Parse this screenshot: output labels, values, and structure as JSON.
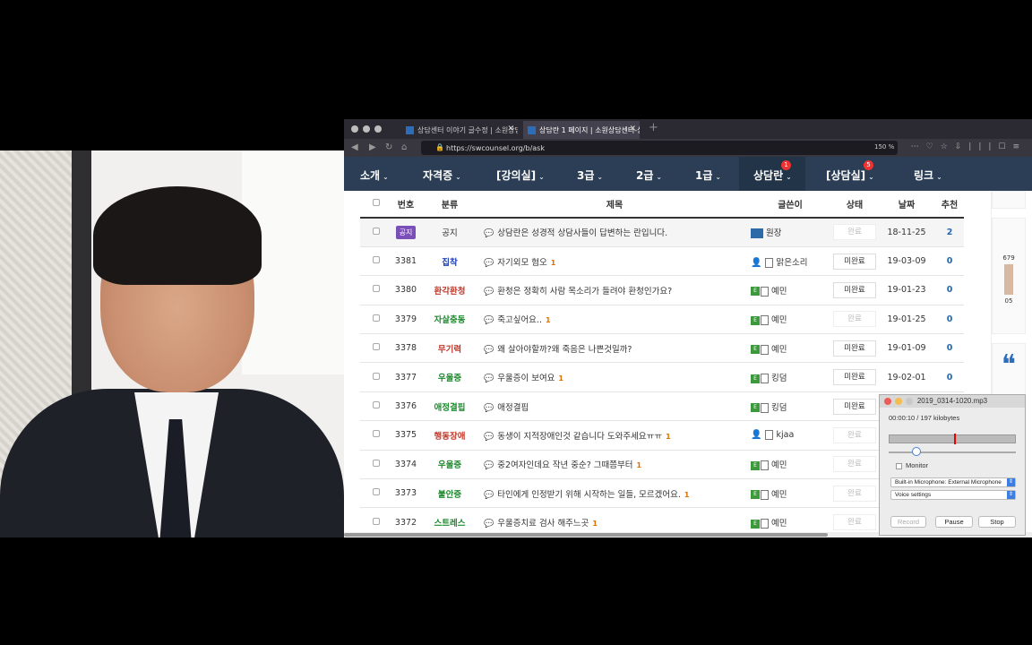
{
  "browser": {
    "tabs": [
      {
        "title": "상담센터 이야기 글수정 | 소원상담센"
      },
      {
        "title": "상담란 1 페이지 | 소원상담센터-상담"
      }
    ],
    "url": "https://swcounsel.org/b/ask",
    "zoom": "150 %"
  },
  "nav": {
    "items": [
      {
        "label": "소개"
      },
      {
        "label": "자격증"
      },
      {
        "label": "[강의실]"
      },
      {
        "label": "3급"
      },
      {
        "label": "2급"
      },
      {
        "label": "1급"
      },
      {
        "label": "상담란",
        "badge": "1"
      },
      {
        "label": "[상담실]",
        "badge": "5"
      },
      {
        "label": "링크"
      }
    ]
  },
  "table": {
    "headers": [
      "번호",
      "분류",
      "제목",
      "글쓴이",
      "상태",
      "날짜",
      "추천"
    ],
    "rows": [
      {
        "num": "공지",
        "cat": "공지",
        "cat_color": "#333333",
        "title": "상담란은 성경적 상담사들이 답변하는 란입니다.",
        "comments": "",
        "author": "원장",
        "status": "완료",
        "date": "18-11-25",
        "rec": "2"
      },
      {
        "num": "3381",
        "cat": "집착",
        "cat_color": "#1f3fb0",
        "title": "자기외모 혐오",
        "comments": "1",
        "author": "맑은소리",
        "status": "미완료",
        "date": "19-03-09",
        "rec": "0"
      },
      {
        "num": "3380",
        "cat": "환각환청",
        "cat_color": "#c0392b",
        "title": "환청은 정확히 사람 목소리가 들려야 환청인가요?",
        "comments": "",
        "author": "예민",
        "status": "미완료",
        "date": "19-01-23",
        "rec": "0"
      },
      {
        "num": "3379",
        "cat": "자살충동",
        "cat_color": "#1e8a2e",
        "title": "죽고싶어요..",
        "comments": "1",
        "author": "예민",
        "status": "완료",
        "date": "19-01-25",
        "rec": "0"
      },
      {
        "num": "3378",
        "cat": "무기력",
        "cat_color": "#c0392b",
        "title": "왜 살아야할까?왜 죽음은 나쁜것일까?",
        "comments": "",
        "author": "예민",
        "status": "미완료",
        "date": "19-01-09",
        "rec": "0"
      },
      {
        "num": "3377",
        "cat": "우울증",
        "cat_color": "#1e8a2e",
        "title": "우울증이 보여요",
        "comments": "1",
        "author": "킹덤",
        "status": "미완료",
        "date": "19-02-01",
        "rec": "0"
      },
      {
        "num": "3376",
        "cat": "애정결핍",
        "cat_color": "#1e8a2e",
        "title": "애정결핍",
        "comments": "",
        "author": "킹덤",
        "status": "미완료",
        "date": "",
        "rec": ""
      },
      {
        "num": "3375",
        "cat": "행동장애",
        "cat_color": "#c0392b",
        "title": "동생이 지적장애인것 같습니다 도와주세요ㅠㅠ",
        "comments": "1",
        "author": "kjaa",
        "status": "완료",
        "date": "",
        "rec": ""
      },
      {
        "num": "3374",
        "cat": "우울증",
        "cat_color": "#1e8a2e",
        "title": "중2여자인데요 작년 중순? 그때쯤부터",
        "comments": "1",
        "author": "예민",
        "status": "완료",
        "date": "",
        "rec": ""
      },
      {
        "num": "3373",
        "cat": "불안증",
        "cat_color": "#1e8a2e",
        "title": "타인에게 인정받기 위해 시작하는 일들, 모르겠어요.",
        "comments": "1",
        "author": "예민",
        "status": "완료",
        "date": "",
        "rec": ""
      },
      {
        "num": "3372",
        "cat": "스트레스",
        "cat_color": "#1e8a2e",
        "title": "우울증치료 검사 해주느곳",
        "comments": "1",
        "author": "예민",
        "status": "완료",
        "date": "",
        "rec": ""
      }
    ]
  },
  "sidebar": {
    "counter_top": "679",
    "counter_bottom": "05"
  },
  "recorder": {
    "title": "2019_0314-1020.mp3",
    "time": "00:00:10  /  197 kilobytes",
    "monitor_label": "Monitor",
    "input_device": "Built-in Microphone: External Microphone",
    "voice_settings": "Voice settings",
    "record_label": "Record",
    "pause_label": "Pause",
    "stop_label": "Stop",
    "level": 0.55
  },
  "colors": {
    "nav_bg": "#2b3e55",
    "accent": "#2169b3"
  }
}
